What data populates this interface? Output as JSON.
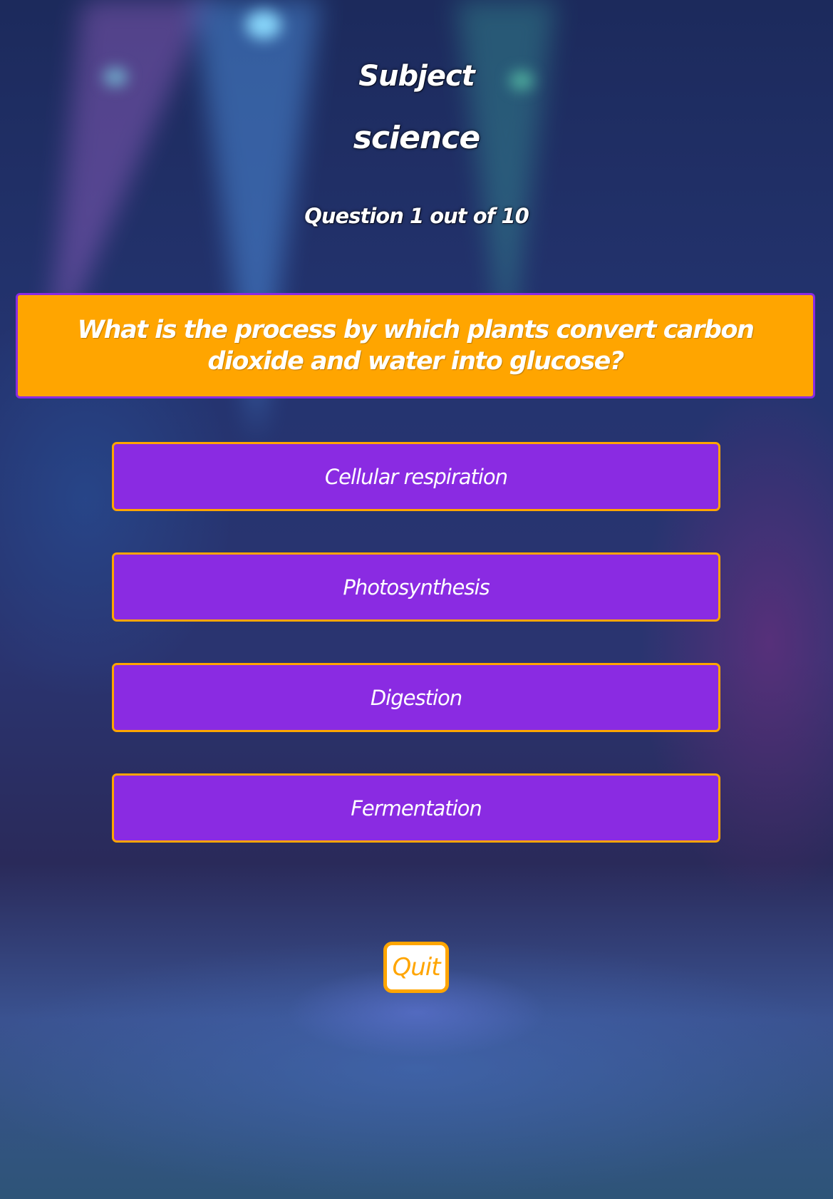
{
  "header": {
    "subject_label": "Subject",
    "subject_value": "science",
    "progress": "Question 1 out of 10"
  },
  "question": {
    "text": "What is the process by which plants convert carbon dioxide and water into glucose?"
  },
  "options": [
    "Cellular respiration",
    "Photosynthesis",
    "Digestion",
    "Fermentation"
  ],
  "quit_label": "Quit",
  "colors": {
    "accent_orange": "#ffa500",
    "option_purple": "#8a2be2",
    "text_white": "#ffffff"
  },
  "background": "stage-spotlights"
}
